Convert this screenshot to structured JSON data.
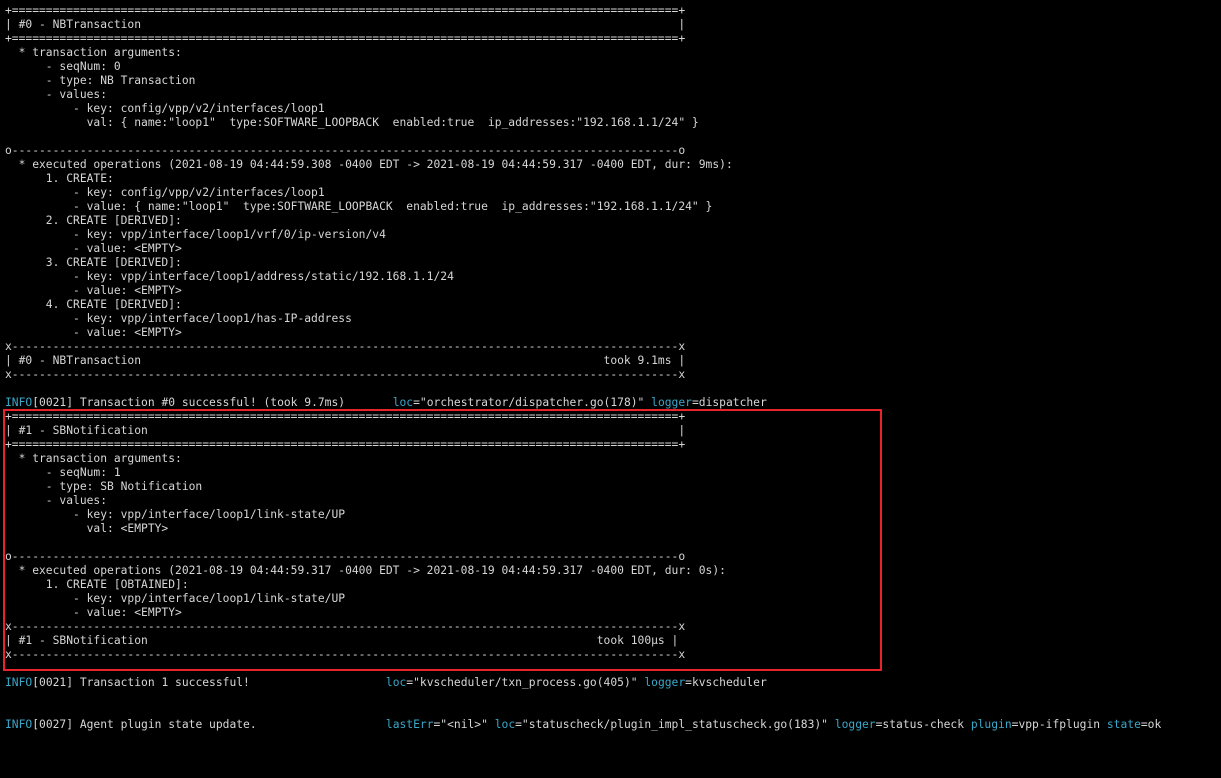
{
  "accent": "#3aa7c9",
  "highlight_color": "#e8242a",
  "lines": [
    "+==================================================================================================+",
    "| #0 - NBTransaction                                                                               |",
    "+==================================================================================================+",
    "  * transaction arguments:",
    "      - seqNum: 0",
    "      - type: NB Transaction",
    "      - values:",
    "          - key: config/vpp/v2/interfaces/loop1",
    "            val: { name:\"loop1\"  type:SOFTWARE_LOOPBACK  enabled:true  ip_addresses:\"192.168.1.1/24\" }",
    "",
    "o--------------------------------------------------------------------------------------------------o",
    "  * executed operations (2021-08-19 04:44:59.308 -0400 EDT -> 2021-08-19 04:44:59.317 -0400 EDT, dur: 9ms):",
    "      1. CREATE:",
    "          - key: config/vpp/v2/interfaces/loop1",
    "          - value: { name:\"loop1\"  type:SOFTWARE_LOOPBACK  enabled:true  ip_addresses:\"192.168.1.1/24\" }",
    "      2. CREATE [DERIVED]:",
    "          - key: vpp/interface/loop1/vrf/0/ip-version/v4",
    "          - value: <EMPTY>",
    "      3. CREATE [DERIVED]:",
    "          - key: vpp/interface/loop1/address/static/192.168.1.1/24",
    "          - value: <EMPTY>",
    "      4. CREATE [DERIVED]:",
    "          - key: vpp/interface/loop1/has-IP-address",
    "          - value: <EMPTY>",
    "x--------------------------------------------------------------------------------------------------x",
    "| #0 - NBTransaction                                                                    took 9.1ms |",
    "x--------------------------------------------------------------------------------------------------x",
    "",
    "",
    "+==================================================================================================+",
    "| #1 - SBNotification                                                                              |",
    "+==================================================================================================+",
    "  * transaction arguments:",
    "      - seqNum: 1",
    "      - type: SB Notification",
    "      - values:",
    "          - key: vpp/interface/loop1/link-state/UP",
    "            val: <EMPTY>",
    "",
    "o--------------------------------------------------------------------------------------------------o",
    "  * executed operations (2021-08-19 04:44:59.317 -0400 EDT -> 2021-08-19 04:44:59.317 -0400 EDT, dur: 0s):",
    "      1. CREATE [OBTAINED]:",
    "          - key: vpp/interface/loop1/link-state/UP",
    "          - value: <EMPTY>",
    "x--------------------------------------------------------------------------------------------------x",
    "| #1 - SBNotification                                                                  took 100µs |",
    "x--------------------------------------------------------------------------------------------------x"
  ],
  "log_tx0": {
    "level": "INFO",
    "message": "[0021] Transaction #0 successful! (took 9.7ms)       ",
    "loc_key": "loc",
    "loc_value": "=\"orchestrator/dispatcher.go(178)\" ",
    "logger_key": "logger",
    "logger_value": "=dispatcher"
  },
  "log_tx1": {
    "level": "INFO",
    "message": "[0021] Transaction 1 successful!                    ",
    "loc_key": "loc",
    "loc_value": "=\"kvscheduler/txn_process.go(405)\" ",
    "logger_key": "logger",
    "logger_value": "=kvscheduler"
  },
  "log_state": {
    "level": "INFO",
    "message": "[0027] Agent plugin state update.                   ",
    "lasterr_key": "lastErr",
    "lasterr_value": "=\"<nil>\" ",
    "loc_key": "loc",
    "loc_value": "=\"statuscheck/plugin_impl_statuscheck.go(183)\" ",
    "logger_key": "logger",
    "logger_value": "=status-check ",
    "plugin_key": "plugin",
    "plugin_value": "=vpp-ifplugin ",
    "state_key": "state",
    "state_value": "=ok"
  }
}
